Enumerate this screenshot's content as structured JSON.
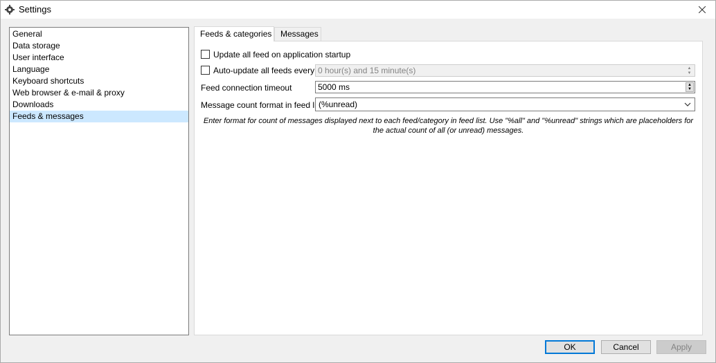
{
  "window": {
    "title": "Settings"
  },
  "categories": [
    {
      "label": "General"
    },
    {
      "label": "Data storage"
    },
    {
      "label": "User interface"
    },
    {
      "label": "Language"
    },
    {
      "label": "Keyboard shortcuts"
    },
    {
      "label": "Web browser & e-mail & proxy"
    },
    {
      "label": "Downloads"
    },
    {
      "label": "Feeds & messages",
      "selected": true
    }
  ],
  "tabs": [
    {
      "label": "Feeds & categories",
      "active": true
    },
    {
      "label": "Messages"
    }
  ],
  "feeds": {
    "update_on_startup_label": "Update all feed on application startup",
    "auto_update_label": "Auto-update all feeds every",
    "auto_update_interval": "0 hour(s) and 15 minute(s)",
    "timeout_label": "Feed connection timeout",
    "timeout_value": "5000 ms",
    "count_format_label": "Message count format in feed list",
    "count_format_value": "(%unread)",
    "hint": "Enter format for count of messages displayed next to each feed/category in feed list. Use \"%all\" and \"%unread\" strings which are placeholders for the actual count of all (or unread) messages."
  },
  "buttons": {
    "ok": "OK",
    "cancel": "Cancel",
    "apply": "Apply"
  }
}
